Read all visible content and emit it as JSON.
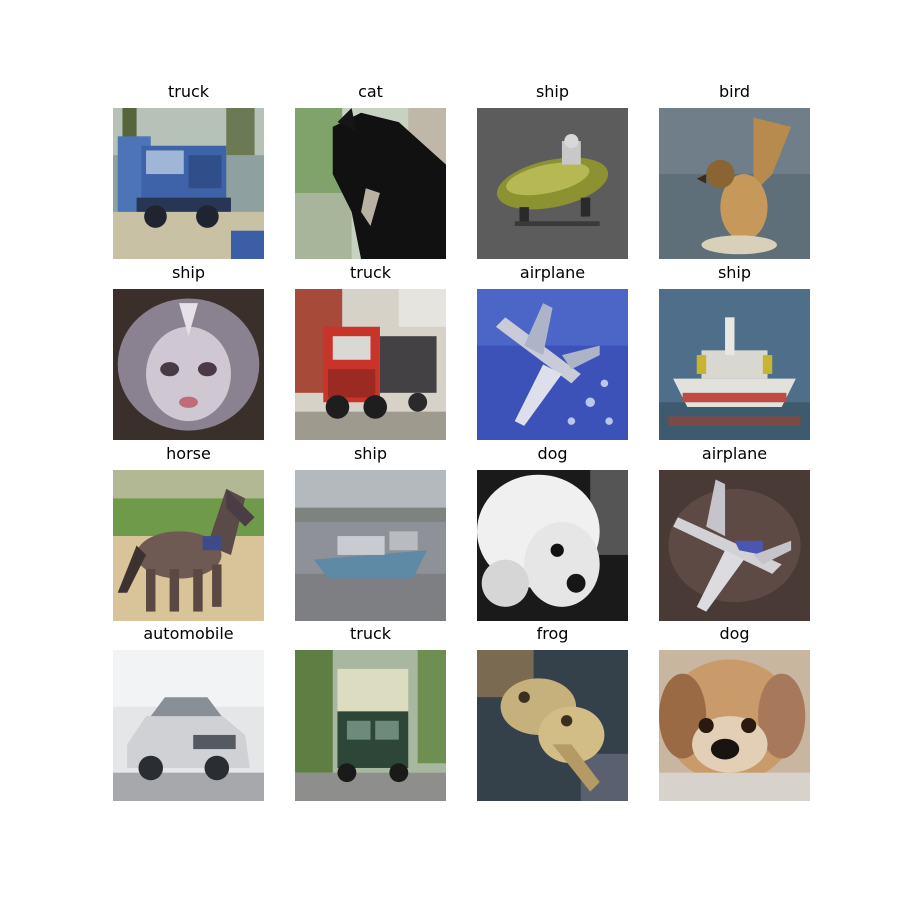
{
  "figure": {
    "images": [
      {
        "label": "truck"
      },
      {
        "label": "cat"
      },
      {
        "label": "ship"
      },
      {
        "label": "bird"
      },
      {
        "label": "ship"
      },
      {
        "label": "truck"
      },
      {
        "label": "airplane"
      },
      {
        "label": "ship"
      },
      {
        "label": "horse"
      },
      {
        "label": "ship"
      },
      {
        "label": "dog"
      },
      {
        "label": "airplane"
      },
      {
        "label": "automobile"
      },
      {
        "label": "truck"
      },
      {
        "label": "frog"
      },
      {
        "label": "dog"
      }
    ]
  }
}
